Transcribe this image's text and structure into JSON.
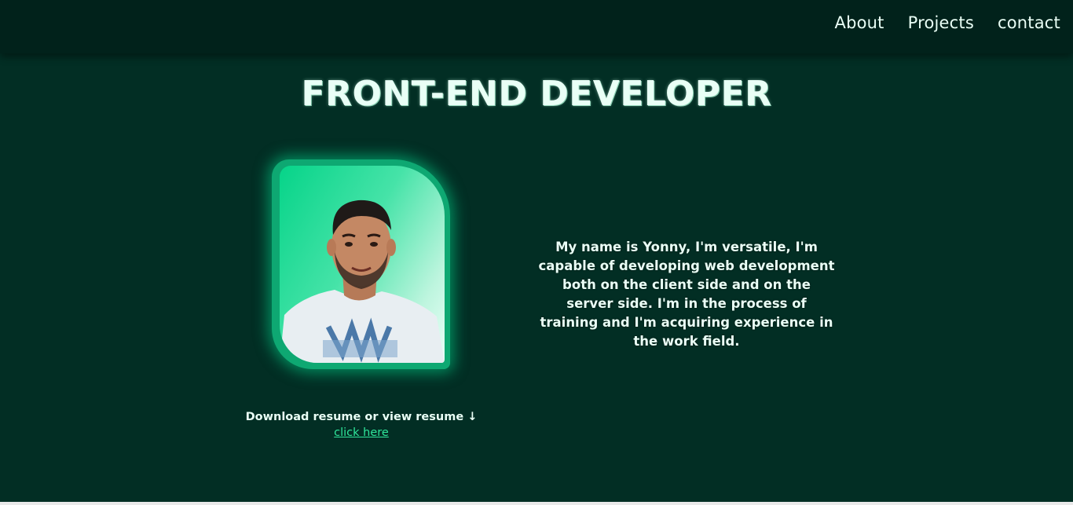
{
  "nav": {
    "items": [
      {
        "label": "About"
      },
      {
        "label": "Projects"
      },
      {
        "label": "contact"
      }
    ]
  },
  "hero": {
    "title": "FRONT-END DEVELOPER",
    "bio": "My name is Yonny, I'm versatile, I'm capable of developing web development both on the client side and on the server side. I'm in the process of training and I'm acquiring experience in the work field."
  },
  "resume": {
    "text": "Download resume or view resume ↓",
    "link_label": "click here"
  },
  "colors": {
    "background": "#022e24",
    "topbar": "#01221b",
    "accent": "#0ea872",
    "link": "#2fe59a",
    "text": "#eafff6"
  }
}
